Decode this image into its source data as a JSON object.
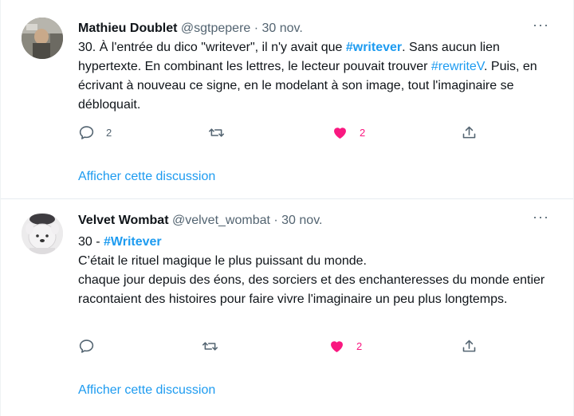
{
  "tweets": [
    {
      "name": "Mathieu Doublet",
      "handle": "@sgtpepere",
      "sep": " · ",
      "date": "30 nov.",
      "more": "···",
      "body": {
        "p1": "30. À l'entrée du dico \"writever\", il n'y avait que ",
        "tag1": "#writever",
        "p2": ". Sans aucun lien hypertexte. En combinant les lettres, le lecteur pouvait trouver ",
        "tag2": "#rewriteV",
        "p3": ". Puis, en écrivant à nouveau ce signe, en le modelant à son image, tout l'imaginaire se débloquait."
      },
      "reply_count": "2",
      "retweet_count": "",
      "like_count": "2",
      "show_thread": "Afficher cette discussion"
    },
    {
      "name": "Velvet Wombat",
      "handle": "@velvet_wombat",
      "sep": " · ",
      "date": "30 nov.",
      "more": "···",
      "body": {
        "p1": "30 - ",
        "tag1": "#Writever",
        "line2": "C’était le rituel magique le plus puissant du monde.",
        "line3": "chaque jour depuis des éons, des sorciers et des enchanteresses du monde entier racontaient des histoires pour faire vivre l'imaginaire un peu plus longtemps."
      },
      "reply_count": "",
      "retweet_count": "",
      "like_count": "2",
      "show_thread": "Afficher cette discussion"
    }
  ],
  "icons": {
    "reply": "reply-icon",
    "retweet": "retweet-icon",
    "like": "heart-filled-icon",
    "share": "share-icon",
    "more": "more-icon"
  },
  "colors": {
    "accent": "#1d9bf0",
    "like": "#f91880",
    "secondary_text": "#536471"
  }
}
